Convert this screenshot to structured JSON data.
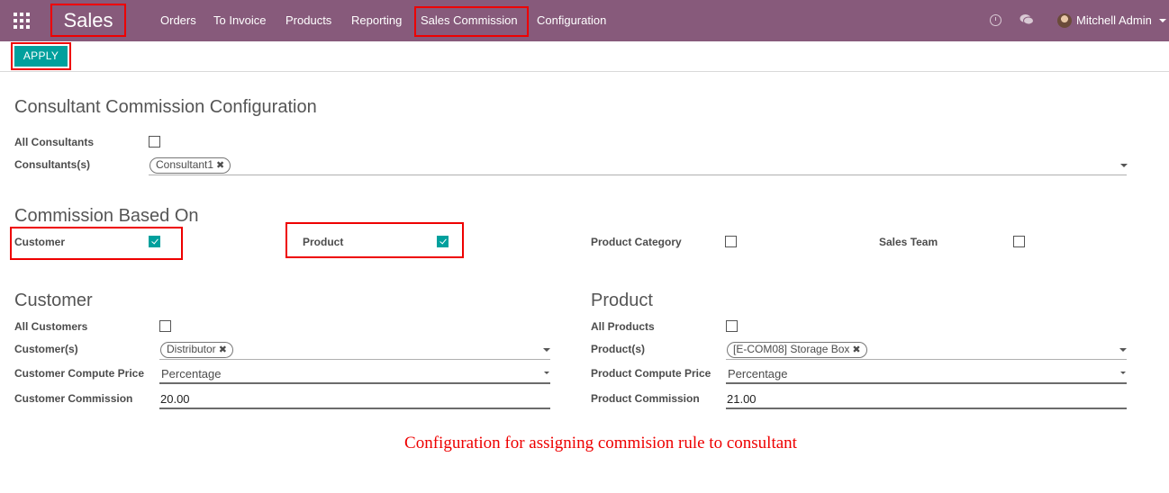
{
  "navbar": {
    "apps_icon": "apps-grid-icon",
    "brand": "Sales",
    "menu": [
      "Orders",
      "To Invoice",
      "Products",
      "Reporting",
      "Sales Commission",
      "Configuration"
    ],
    "active_menu": "Sales Commission",
    "activity_icon": "clock-icon",
    "messages_icon": "chat-icon",
    "user_name": "Mitchell Admin",
    "background_color": "#875a7b"
  },
  "control_panel": {
    "apply_label": "APPLY",
    "apply_color": "#00a09d"
  },
  "consultant_section": {
    "title": "Consultant Commission Configuration",
    "all_consultants_label": "All Consultants",
    "all_consultants_checked": false,
    "consultants_label": "Consultants(s)",
    "consultants_tags": [
      "Consultant1"
    ]
  },
  "commission_based_on": {
    "title": "Commission Based On",
    "options": [
      {
        "label": "Customer",
        "checked": true
      },
      {
        "label": "Product",
        "checked": true
      },
      {
        "label": "Product Category",
        "checked": false
      },
      {
        "label": "Sales Team",
        "checked": false
      }
    ]
  },
  "customer_section": {
    "title": "Customer",
    "all_label": "All Customers",
    "all_checked": false,
    "items_label": "Customer(s)",
    "items_tags": [
      "Distributor"
    ],
    "compute_label": "Customer Compute Price",
    "compute_value": "Percentage",
    "commission_label": "Customer Commission",
    "commission_value": "20.00"
  },
  "product_section": {
    "title": "Product",
    "all_label": "All Products",
    "all_checked": false,
    "items_label": "Product(s)",
    "items_tags": [
      "[E-COM08] Storage Box"
    ],
    "compute_label": "Product Compute Price",
    "compute_value": "Percentage",
    "commission_label": "Product Commission",
    "commission_value": "21.00"
  },
  "caption": "Configuration for assigning commision rule to consultant",
  "tag_remove_glyph": "✖",
  "highlight_color": "#ee0000"
}
